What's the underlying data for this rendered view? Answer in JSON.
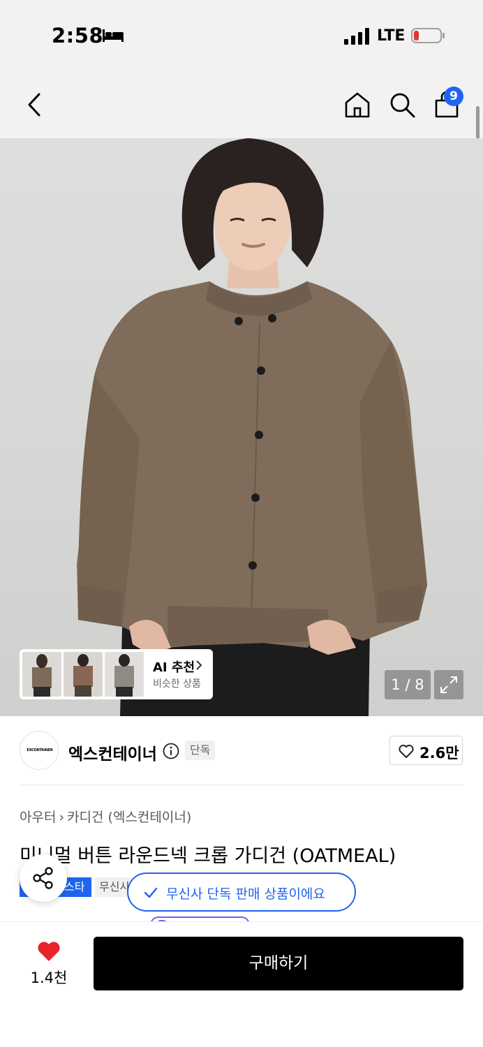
{
  "status_bar": {
    "time": "2:58",
    "network": "LTE",
    "battery_color": "#e5352c",
    "icons": [
      "sleep-bed-icon",
      "signal-icon",
      "battery-icon"
    ]
  },
  "nav": {
    "icons": [
      "back-icon",
      "home-icon",
      "search-icon",
      "shopping-bag-icon"
    ],
    "cart_badge": "9",
    "accent_color": "#1f64f0"
  },
  "gallery": {
    "counter": "1 / 8",
    "ai_recommend": {
      "title": "AI 추천",
      "subtitle": "비슷한 상품"
    }
  },
  "brand": {
    "logo_text": "EXCONTAINER",
    "name": "엑스컨테이너",
    "exclusive_tag": "단독",
    "likes": "2.6만"
  },
  "product": {
    "breadcrumb": [
      "아우터",
      "카디건 (엑스컨테이너)"
    ],
    "title": "미니멀 버튼 라운드넥 크롭 가디건 (OATMEAL)",
    "badge_star": "스타",
    "badge_musinsa": "무신사"
  },
  "toast": {
    "text": "무신사 단독 판매 상품이에요"
  },
  "bottom_bar": {
    "wish_count": "1.4천",
    "buy_label": "구매하기",
    "wish_color": "#e8232b"
  }
}
